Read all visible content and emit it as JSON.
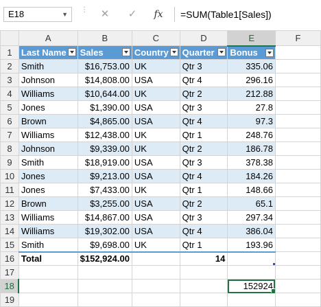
{
  "formula_bar": {
    "name_box": "E18",
    "cancel_symbol": "✕",
    "enter_symbol": "✓",
    "fx_label": "fx",
    "formula": "=SUM(Table1[Sales])"
  },
  "columns": [
    "A",
    "B",
    "C",
    "D",
    "E",
    "F"
  ],
  "selected": {
    "column": "E",
    "row": "18"
  },
  "table_headers": [
    "Last Name",
    "Sales",
    "Country",
    "Quarter",
    "Bonus"
  ],
  "rows": [
    {
      "n": "2",
      "name": "Smith",
      "sales": "$16,753.00",
      "country": "UK",
      "quarter": "Qtr 3",
      "bonus": "335.06"
    },
    {
      "n": "3",
      "name": "Johnson",
      "sales": "$14,808.00",
      "country": "USA",
      "quarter": "Qtr 4",
      "bonus": "296.16"
    },
    {
      "n": "4",
      "name": "Williams",
      "sales": "$10,644.00",
      "country": "UK",
      "quarter": "Qtr 2",
      "bonus": "212.88"
    },
    {
      "n": "5",
      "name": "Jones",
      "sales": "$1,390.00",
      "country": "USA",
      "quarter": "Qtr 3",
      "bonus": "27.8"
    },
    {
      "n": "6",
      "name": "Brown",
      "sales": "$4,865.00",
      "country": "USA",
      "quarter": "Qtr 4",
      "bonus": "97.3"
    },
    {
      "n": "7",
      "name": "Williams",
      "sales": "$12,438.00",
      "country": "UK",
      "quarter": "Qtr 1",
      "bonus": "248.76"
    },
    {
      "n": "8",
      "name": "Johnson",
      "sales": "$9,339.00",
      "country": "UK",
      "quarter": "Qtr 2",
      "bonus": "186.78"
    },
    {
      "n": "9",
      "name": "Smith",
      "sales": "$18,919.00",
      "country": "USA",
      "quarter": "Qtr 3",
      "bonus": "378.38"
    },
    {
      "n": "10",
      "name": "Jones",
      "sales": "$9,213.00",
      "country": "USA",
      "quarter": "Qtr 4",
      "bonus": "184.26"
    },
    {
      "n": "11",
      "name": "Jones",
      "sales": "$7,433.00",
      "country": "UK",
      "quarter": "Qtr 1",
      "bonus": "148.66"
    },
    {
      "n": "12",
      "name": "Brown",
      "sales": "$3,255.00",
      "country": "USA",
      "quarter": "Qtr 2",
      "bonus": "65.1"
    },
    {
      "n": "13",
      "name": "Williams",
      "sales": "$14,867.00",
      "country": "USA",
      "quarter": "Qtr 3",
      "bonus": "297.34"
    },
    {
      "n": "14",
      "name": "Williams",
      "sales": "$19,302.00",
      "country": "USA",
      "quarter": "Qtr 4",
      "bonus": "386.04"
    },
    {
      "n": "15",
      "name": "Smith",
      "sales": "$9,698.00",
      "country": "UK",
      "quarter": "Qtr 1",
      "bonus": "193.96"
    }
  ],
  "total_row": {
    "n": "16",
    "label": "Total",
    "sales": "$152,924.00",
    "quarter": "14"
  },
  "row_numbers": {
    "header": "1",
    "r17": "17",
    "r18": "18",
    "r19": "19"
  },
  "cell_e18": "152924"
}
